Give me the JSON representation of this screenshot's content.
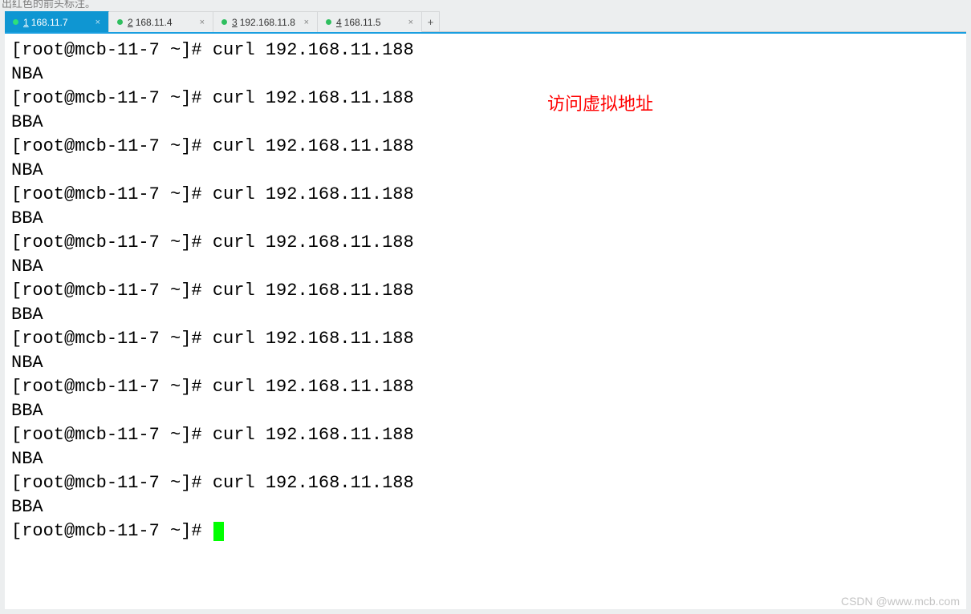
{
  "top_fragment": "出红⾊的前头标注。",
  "tabs": [
    {
      "num": "1",
      "label": "168.11.7",
      "active": true
    },
    {
      "num": "2",
      "label": "168.11.4",
      "active": false
    },
    {
      "num": "3",
      "label": "192.168.11.8",
      "active": false
    },
    {
      "num": "4",
      "label": "168.11.5",
      "active": false
    }
  ],
  "add_tab": "+",
  "close_glyph": "×",
  "terminal": {
    "prompt": "[root@mcb-11-7 ~]# ",
    "command": "curl 192.168.11.188",
    "responses": [
      "NBA",
      "BBA",
      "NBA",
      "BBA",
      "NBA",
      "BBA",
      "NBA",
      "BBA",
      "NBA",
      "BBA"
    ],
    "final_prompt": "[root@mcb-11-7 ~]# "
  },
  "annotation": "访问虚拟地址",
  "watermark": "CSDN @www.mcb.com"
}
